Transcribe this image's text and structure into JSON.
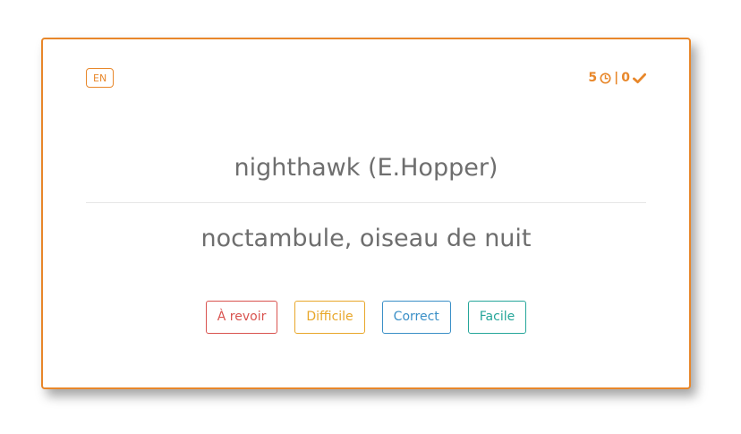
{
  "card": {
    "language_badge": "EN",
    "stats": {
      "pending_count": "5",
      "separator": "|",
      "correct_count": "0",
      "pending_icon": "clock-icon",
      "correct_icon": "check-icon"
    },
    "word": "nighthawk (E.Hopper)",
    "translation": "noctambule, oiseau de nuit",
    "buttons": {
      "revoir": "À revoir",
      "difficile": "Difficile",
      "correct": "Correct",
      "facile": "Facile"
    }
  },
  "colors": {
    "accent": "#e8872a",
    "revoir": "#d9534f",
    "difficile": "#e8a72a",
    "correct": "#3a8fc7",
    "facile": "#26a69a",
    "text": "#6e6e6e"
  }
}
